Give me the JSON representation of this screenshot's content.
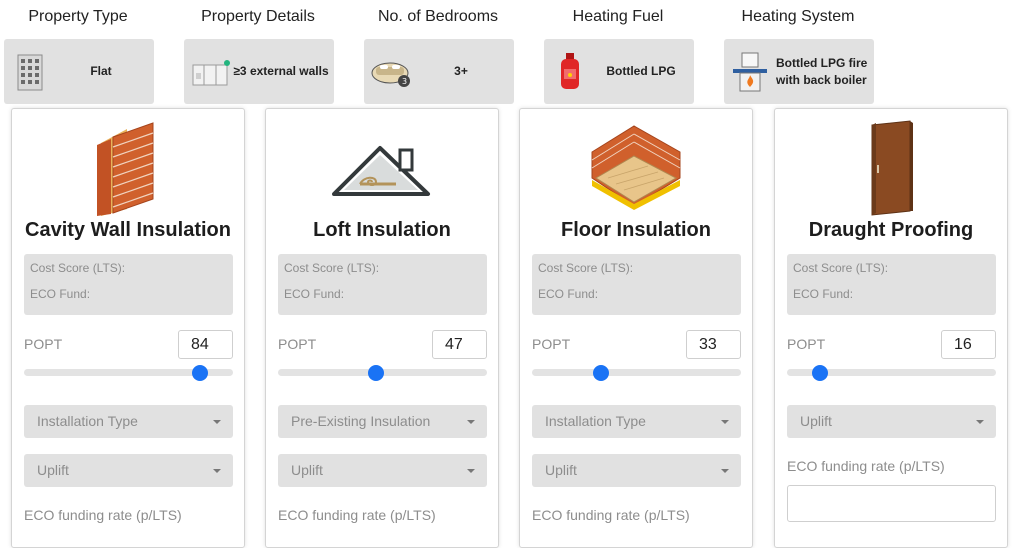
{
  "header": {
    "property_type": {
      "title": "Property Type",
      "value": "Flat",
      "icon": "flat-building-icon"
    },
    "property_details": {
      "title": "Property Details",
      "value": "≥3 external walls",
      "icon": "external-walls-icon"
    },
    "bedrooms": {
      "title": "No. of Bedrooms",
      "value": "3+",
      "icon": "bed-icon"
    },
    "heating_fuel": {
      "title": "Heating Fuel",
      "value": "Bottled LPG",
      "icon": "lpg-bottle-icon"
    },
    "heating_system": {
      "title": "Heating System",
      "value_line1": "Bottled LPG fire",
      "value_line2": "with back boiler",
      "icon": "fireplace-boiler-icon"
    }
  },
  "common": {
    "cost_score_label": "Cost Score (LTS):",
    "eco_fund_label": "ECO Fund:",
    "popt_label": "POPT",
    "eco_rate_label": "ECO funding rate (p/LTS)"
  },
  "cards": [
    {
      "title": "Cavity Wall Insulation",
      "icon": "cavity-wall-icon",
      "popt": 84,
      "select1": "Installation Type",
      "select2": "Uplift"
    },
    {
      "title": "Loft Insulation",
      "icon": "loft-icon",
      "popt": 47,
      "select1": "Pre-Existing Insulation",
      "select2": "Uplift"
    },
    {
      "title": "Floor Insulation",
      "icon": "floor-icon",
      "popt": 33,
      "select1": "Installation Type",
      "select2": "Uplift"
    },
    {
      "title": "Draught Proofing",
      "icon": "door-icon",
      "popt": 16,
      "select1": "Uplift"
    }
  ],
  "colors": {
    "accent": "#1a73f5",
    "panel": "#e1e1e1",
    "brick": "#d0602c"
  }
}
